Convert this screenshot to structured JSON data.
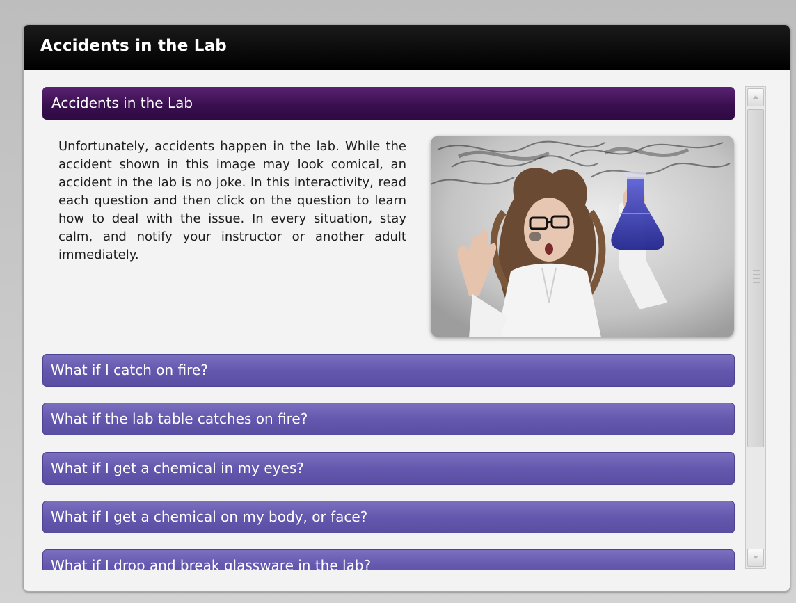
{
  "window": {
    "title": "Accidents in the Lab"
  },
  "section": {
    "header": "Accidents in the Lab",
    "intro": "Unfortunately, accidents happen in the lab. While the accident shown in this image may look comical, an accident in the lab is no joke. In this interactivity, read each question and then click on the question to learn how to deal with the issue. In every situation, stay calm, and notify your instructor or another adult immediately."
  },
  "questions": [
    {
      "label": "What if I catch on fire?"
    },
    {
      "label": "What if the lab table catches on fire?"
    },
    {
      "label": "What if I get a chemical in my eyes?"
    },
    {
      "label": "What if I get a chemical on my body, or face?"
    },
    {
      "label": "What if I drop and break glassware in the lab?"
    }
  ],
  "colors": {
    "title_bar": "#000000",
    "section_header": "#3a0f50",
    "question_bar": "#6458ae"
  },
  "icons": {
    "scroll_up": "chevron-up-icon",
    "scroll_down": "chevron-down-icon"
  }
}
